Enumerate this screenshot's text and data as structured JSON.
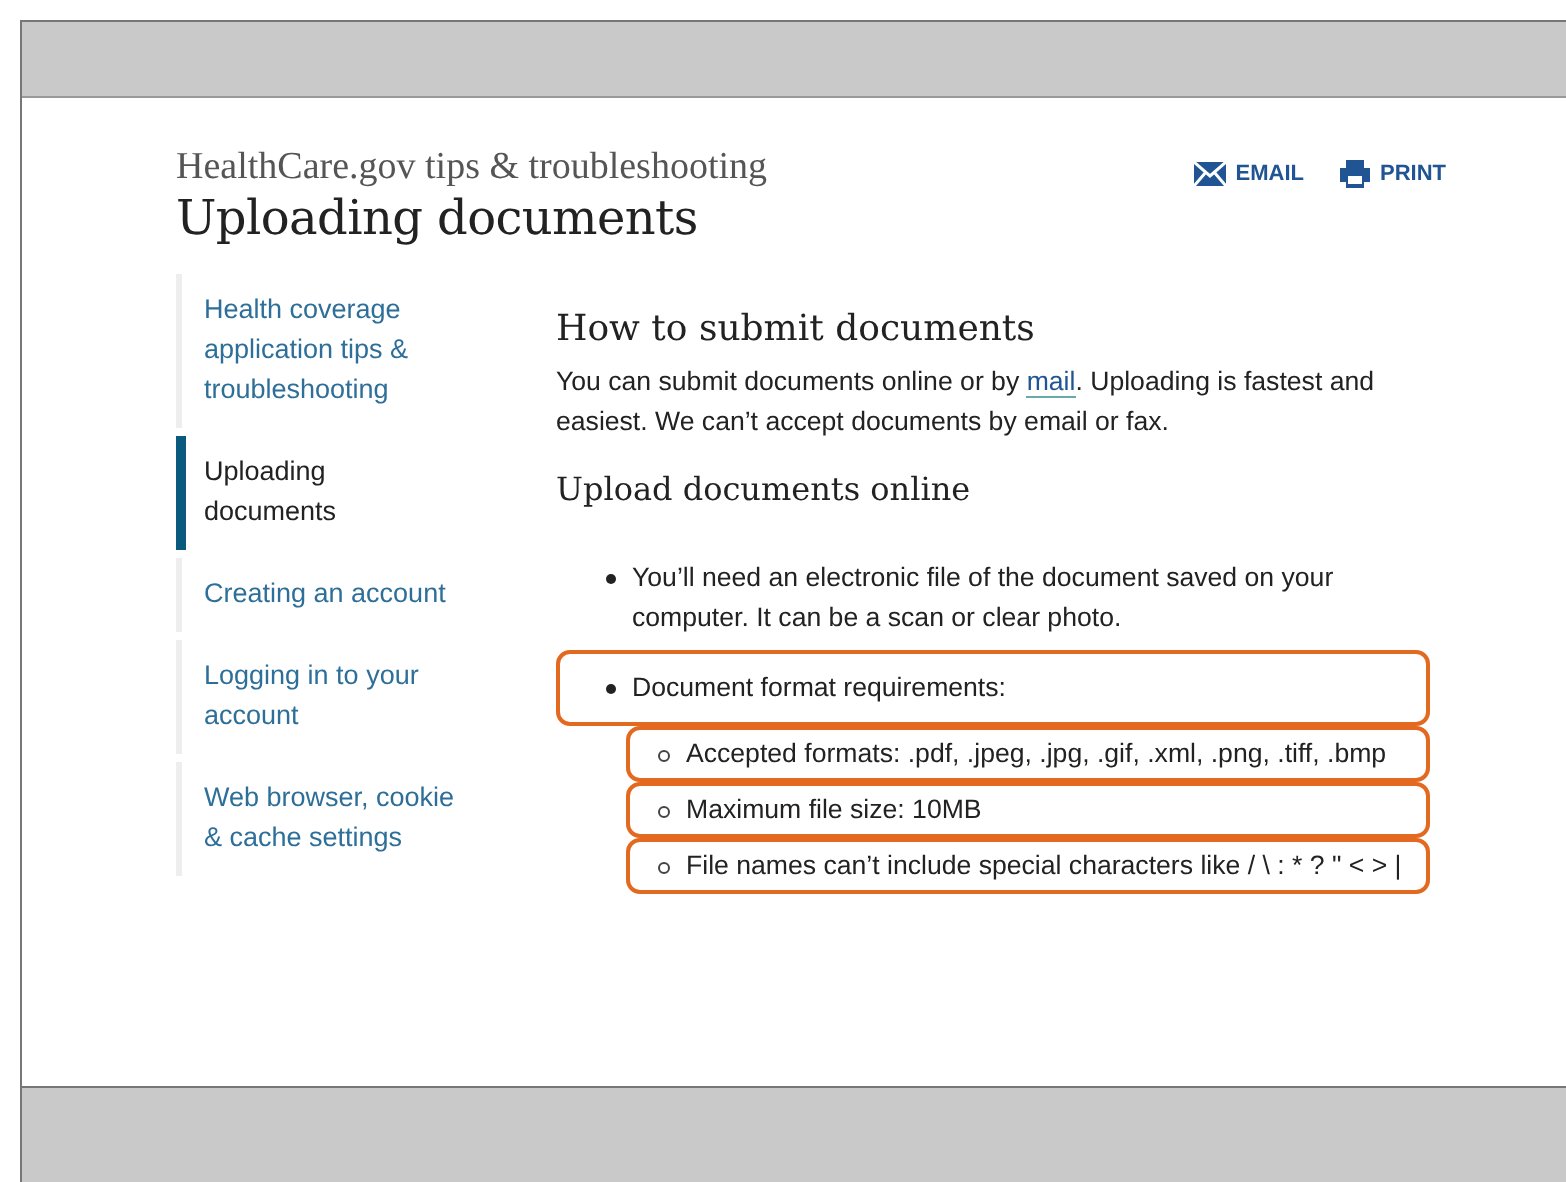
{
  "header": {
    "site": "HealthCare.gov tips & troubleshooting",
    "title": "Uploading documents",
    "actions": [
      {
        "kind": "email",
        "label": "EMAIL"
      },
      {
        "kind": "print",
        "label": "PRINT"
      }
    ]
  },
  "sidebar": {
    "items": [
      {
        "label": "Health coverage application tips & troubleshooting",
        "selected": false
      },
      {
        "label": "Uploading documents",
        "selected": true
      },
      {
        "label": "Creating an account",
        "selected": false
      },
      {
        "label": "Logging in to your account",
        "selected": false
      },
      {
        "label": "Web browser, cookie & cache settings",
        "selected": false
      }
    ]
  },
  "content": {
    "heading": "How to submit documents",
    "intro": {
      "before": "You can submit documents online or by ",
      "link": "mail",
      "after": ". Uploading is fastest and easiest. We can’t accept documents by email or fax."
    },
    "subheading": "Upload documents online",
    "bullets": [
      {
        "text": "You’ll need an electronic file of the document saved on your computer. It can be a scan or clear photo.",
        "highlighted": false
      },
      {
        "text": "Document format requirements:",
        "highlighted": true,
        "children": [
          {
            "text": "Accepted formats: .pdf, .jpeg, .jpg, .gif, .xml, .png, .tiff, .bmp",
            "highlighted": true
          },
          {
            "text": "Maximum file size: 10MB",
            "highlighted": true
          },
          {
            "text": "File names can’t include special characters like / \\ : * ? \" < > |",
            "highlighted": true
          }
        ]
      }
    ]
  }
}
